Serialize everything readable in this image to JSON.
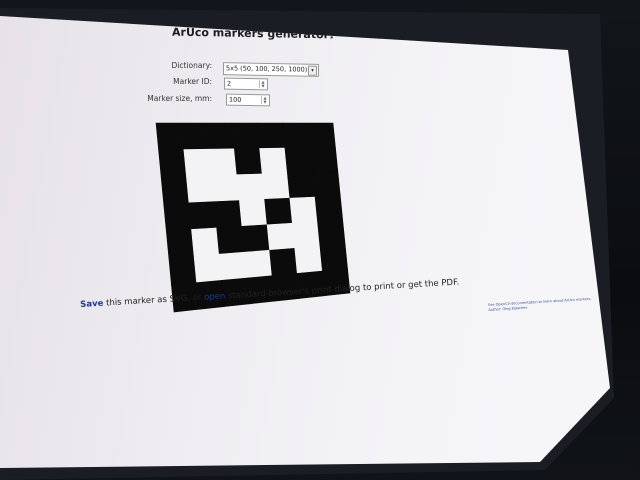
{
  "page": {
    "title": "ArUco markers generator!"
  },
  "form": {
    "dictionary_label": "Dictionary:",
    "dictionary_value": "5x5 (50, 100, 250, 1000)",
    "marker_id_label": "Marker ID:",
    "marker_id_value": "2",
    "marker_size_label": "Marker size, mm:",
    "marker_size_value": "100"
  },
  "marker": {
    "grid_size": 7,
    "cells": [
      [
        1,
        1,
        1,
        1,
        1,
        1,
        1
      ],
      [
        1,
        0,
        0,
        1,
        0,
        1,
        1
      ],
      [
        1,
        0,
        0,
        0,
        0,
        1,
        1
      ],
      [
        1,
        1,
        1,
        0,
        1,
        0,
        1
      ],
      [
        1,
        0,
        1,
        1,
        0,
        0,
        1
      ],
      [
        1,
        0,
        0,
        0,
        1,
        0,
        1
      ],
      [
        1,
        1,
        1,
        1,
        1,
        1,
        1
      ]
    ],
    "colors": {
      "black": "#0b0b0b",
      "white": "#f3f2f5"
    }
  },
  "footer": {
    "save_link": "Save",
    "save_text_1": " this marker as SVG, or ",
    "open_link": "open",
    "save_text_2": " standard browser's print dialog to print or get the PDF."
  },
  "credit": {
    "line1": "See OpenCV documentation to learn about ArUco markers.",
    "line2": "Author: Oleg Kalachev"
  },
  "icons": {
    "select_arrow": "chevron-down-icon",
    "spinner": "spinner-arrows-icon"
  }
}
